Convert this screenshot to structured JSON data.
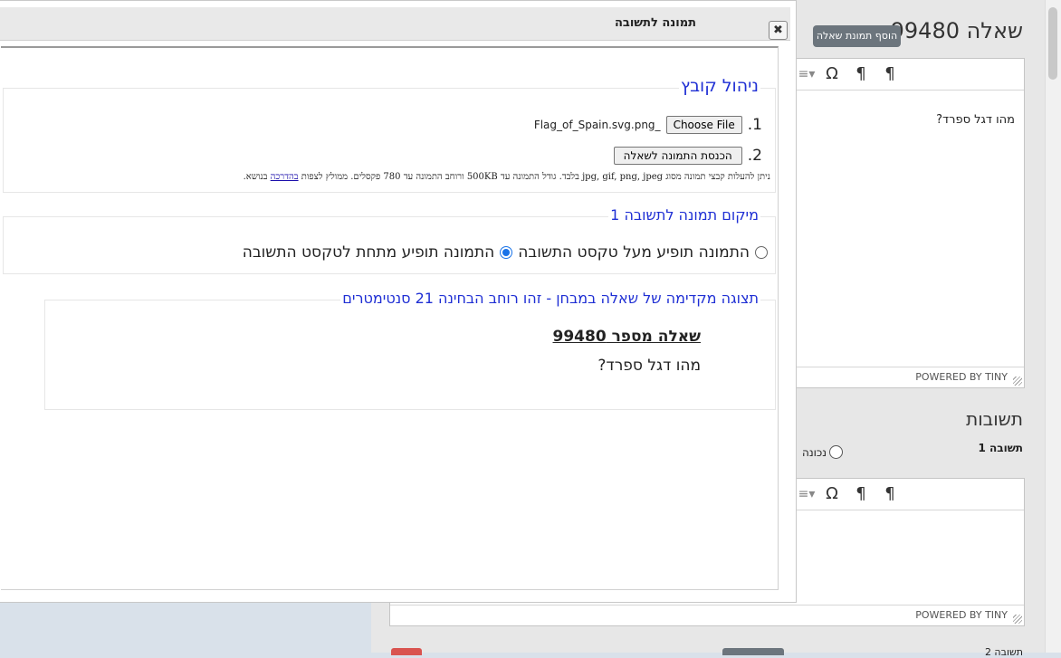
{
  "background": {
    "question_title": "שאלה 99480",
    "add_question_image_label": "הוסף תמונת שאלה",
    "editor1": {
      "content": "מהו דגל ספרד?",
      "powered_by": "POWERED BY TINY"
    },
    "answers_heading": "תשובות",
    "answer1_label": "תשובה 1",
    "correct_label": "נכונה",
    "editor2": {
      "powered_by": "POWERED BY TINY"
    },
    "bottom_label": "תשובה 2"
  },
  "dialog": {
    "title": "תמונה לתשובה",
    "close_glyph": "✖",
    "file_section": {
      "legend": "ניהול קובץ",
      "step1_number": "1.",
      "choose_file_label": "Choose File",
      "chosen_file_name": "Flag_of_Spain.svg.png_",
      "step2_number": "2.",
      "insert_button_label": "הכנסת התמונה לשאלה",
      "note_text": "ניתן להעלות קבצי תמונה מסוג jpg, gif, png, jpeg בלבד. גודל התמונה עד 500KB ורוחב התמונה עד 780 פקסלים. ממולץ לצפות ",
      "note_link": "בהדרכה",
      "note_suffix": " בנושא."
    },
    "position_section": {
      "legend": "מיקום תמונה לתשובה 1",
      "option_above": "התמונה תופיע מעל טקסט התשובה",
      "option_below": "התמונה תופיע מתחת לטקסט התשובה",
      "selected": "below"
    },
    "preview_section": {
      "legend": "תצוגה מקדימה של שאלה במבחן - זהו רוחב הבחינה 21 סנטימטרים",
      "question_heading": "שאלה מספר 99480",
      "question_text": "מהו דגל ספרד?"
    }
  },
  "toolbar_icons": [
    "paragraph-ltr-icon",
    "paragraph-rtl-icon",
    "omega-icon",
    "list-icon"
  ],
  "colors": {
    "accent_blue": "#1f2fd4",
    "secondary_button": "#6c757d",
    "danger_button": "#d9534f"
  }
}
